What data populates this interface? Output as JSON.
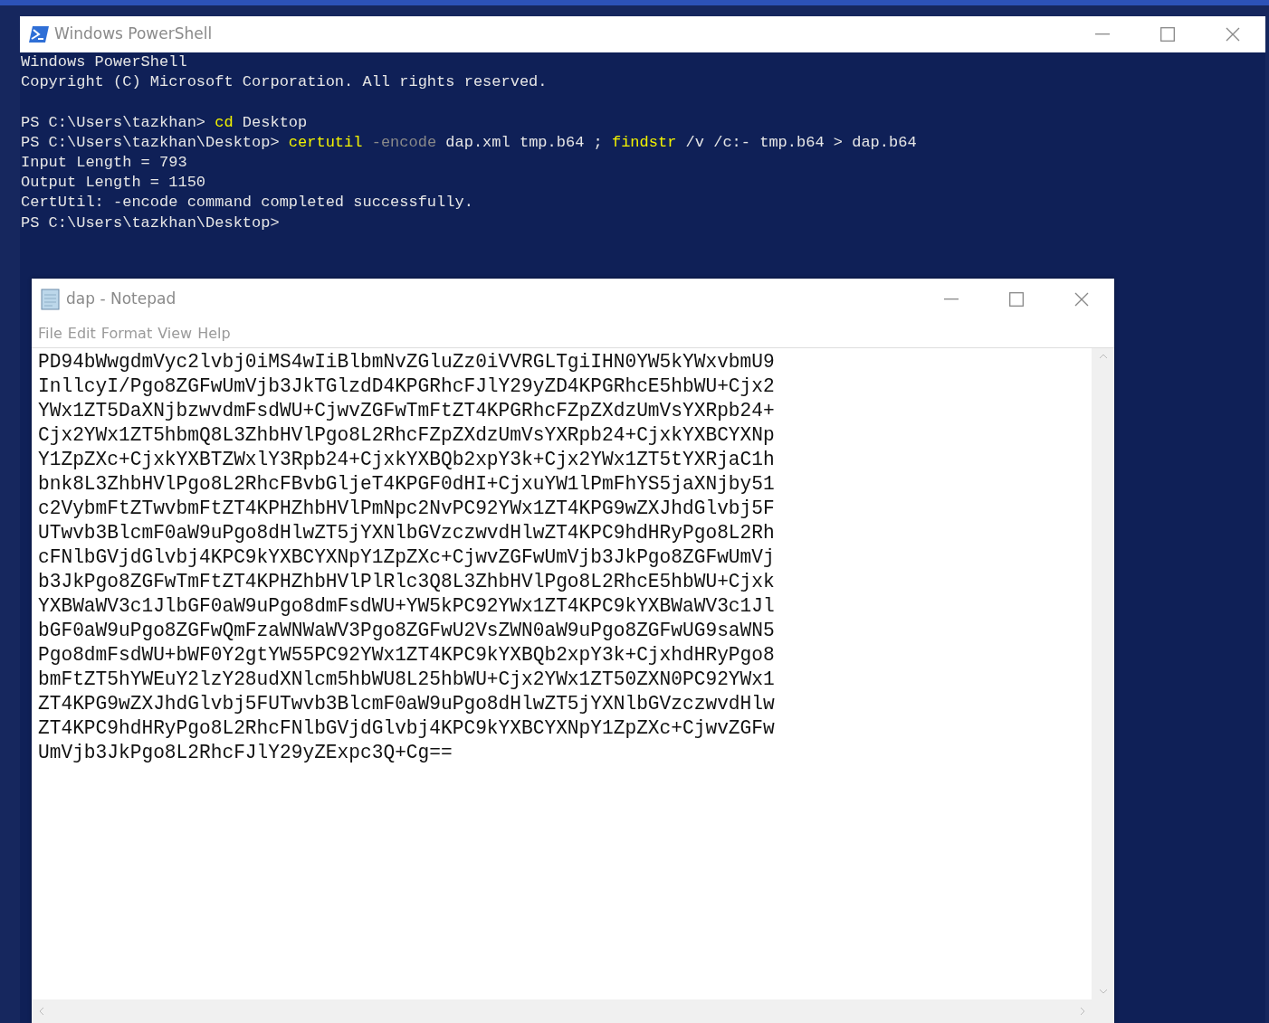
{
  "powershell": {
    "title": "Windows PowerShell",
    "lines": [
      [
        {
          "kind": "plain",
          "text": "Windows PowerShell"
        }
      ],
      [
        {
          "kind": "plain",
          "text": "Copyright (C) Microsoft Corporation. All rights reserved."
        }
      ],
      [
        {
          "kind": "blank"
        },
        {
          "kind": "plain",
          "text": "PS C:\\Users\\tazkhan> "
        },
        {
          "kind": "command",
          "text": "cd"
        },
        {
          "kind": "plain",
          "text": " Desktop"
        }
      ],
      [
        {
          "kind": "plain",
          "text": "PS C:\\Users\\tazkhan\\Desktop> "
        },
        {
          "kind": "command",
          "text": "certutil"
        },
        {
          "kind": "parameter",
          "text": " -encode"
        },
        {
          "kind": "plain",
          "text": " dap.xml tmp.b64 ; "
        },
        {
          "kind": "command",
          "text": "findstr"
        },
        {
          "kind": "plain",
          "text": " /v /c:- tmp.b64 > dap.b64"
        }
      ],
      [
        {
          "kind": "plain",
          "text": "Input Length = 793"
        }
      ],
      [
        {
          "kind": "plain",
          "text": "Output Length = 1150"
        }
      ],
      [
        {
          "kind": "plain",
          "text": "CertUtil: -encode command completed successfully."
        }
      ],
      [
        {
          "kind": "plain",
          "text": "PS C:\\Users\\tazkhan\\Desktop>"
        }
      ]
    ]
  },
  "notepad": {
    "title": "dap - Notepad",
    "menu": [
      "File",
      "Edit",
      "Format",
      "View",
      "Help"
    ],
    "content_lines": [
      "PD94bWwgdmVyc2lvbj0iMS4wIiBlbmNvZGluZz0iVVRGLTgiIHN0YW5kYWxvbmU9",
      "InllcyI/Pgo8ZGFwUmVjb3JkTGlzdD4KPGRhcFJlY29yZD4KPGRhcE5hbWU+Cjx2",
      "YWx1ZT5DaXNjbzwvdmFsdWU+CjwvZGFwTmFtZT4KPGRhcFZpZXdzUmVsYXRpb24+",
      "Cjx2YWx1ZT5hbmQ8L3ZhbHVlPgo8L2RhcFZpZXdzUmVsYXRpb24+CjxkYXBCYXNp",
      "Y1ZpZXc+CjxkYXBTZWxlY3Rpb24+CjxkYXBQb2xpY3k+Cjx2YWx1ZT5tYXRjaC1h",
      "bnk8L3ZhbHVlPgo8L2RhcFBvbGljeT4KPGF0dHI+CjxuYW1lPmFhYS5jaXNjby51",
      "c2VybmFtZTwvbmFtZT4KPHZhbHVlPmNpc2NvPC92YWx1ZT4KPG9wZXJhdGlvbj5F",
      "UTwvb3BlcmF0aW9uPgo8dHlwZT5jYXNlbGVzczwvdHlwZT4KPC9hdHRyPgo8L2Rh",
      "cFNlbGVjdGlvbj4KPC9kYXBCYXNpY1ZpZXc+CjwvZGFwUmVjb3JkPgo8ZGFwUmVj",
      "b3JkPgo8ZGFwTmFtZT4KPHZhbHVlPlRlc3Q8L3ZhbHVlPgo8L2RhcE5hbWU+Cjxk",
      "YXBWaWV3c1JlbGF0aW9uPgo8dmFsdWU+YW5kPC92YWx1ZT4KPC9kYXBWaWV3c1Jl",
      "bGF0aW9uPgo8ZGFwQmFzaWNWaWV3Pgo8ZGFwU2VsZWN0aW9uPgo8ZGFwUG9saWN5",
      "Pgo8dmFsdWU+bWF0Y2gtYW55PC92YWx1ZT4KPC9kYXBQb2xpY3k+CjxhdHRyPgo8",
      "bmFtZT5hYWEuY2lzY28udXNlcm5hbWU8L25hbWU+Cjx2YWx1ZT50ZXN0PC92YWx1",
      "ZT4KPG9wZXJhdGlvbj5FUTwvb3BlcmF0aW9uPgo8dHlwZT5jYXNlbGVzczwvdHlw",
      "ZT4KPC9hdHRyPgo8L2RhcFNlbGVjdGlvbj4KPC9kYXBCYXNpY1ZpZXc+CjwvZGFw",
      "UmVjb3JkPgo8L2RhcFJlY29yZExpc3Q+Cg=="
    ]
  }
}
